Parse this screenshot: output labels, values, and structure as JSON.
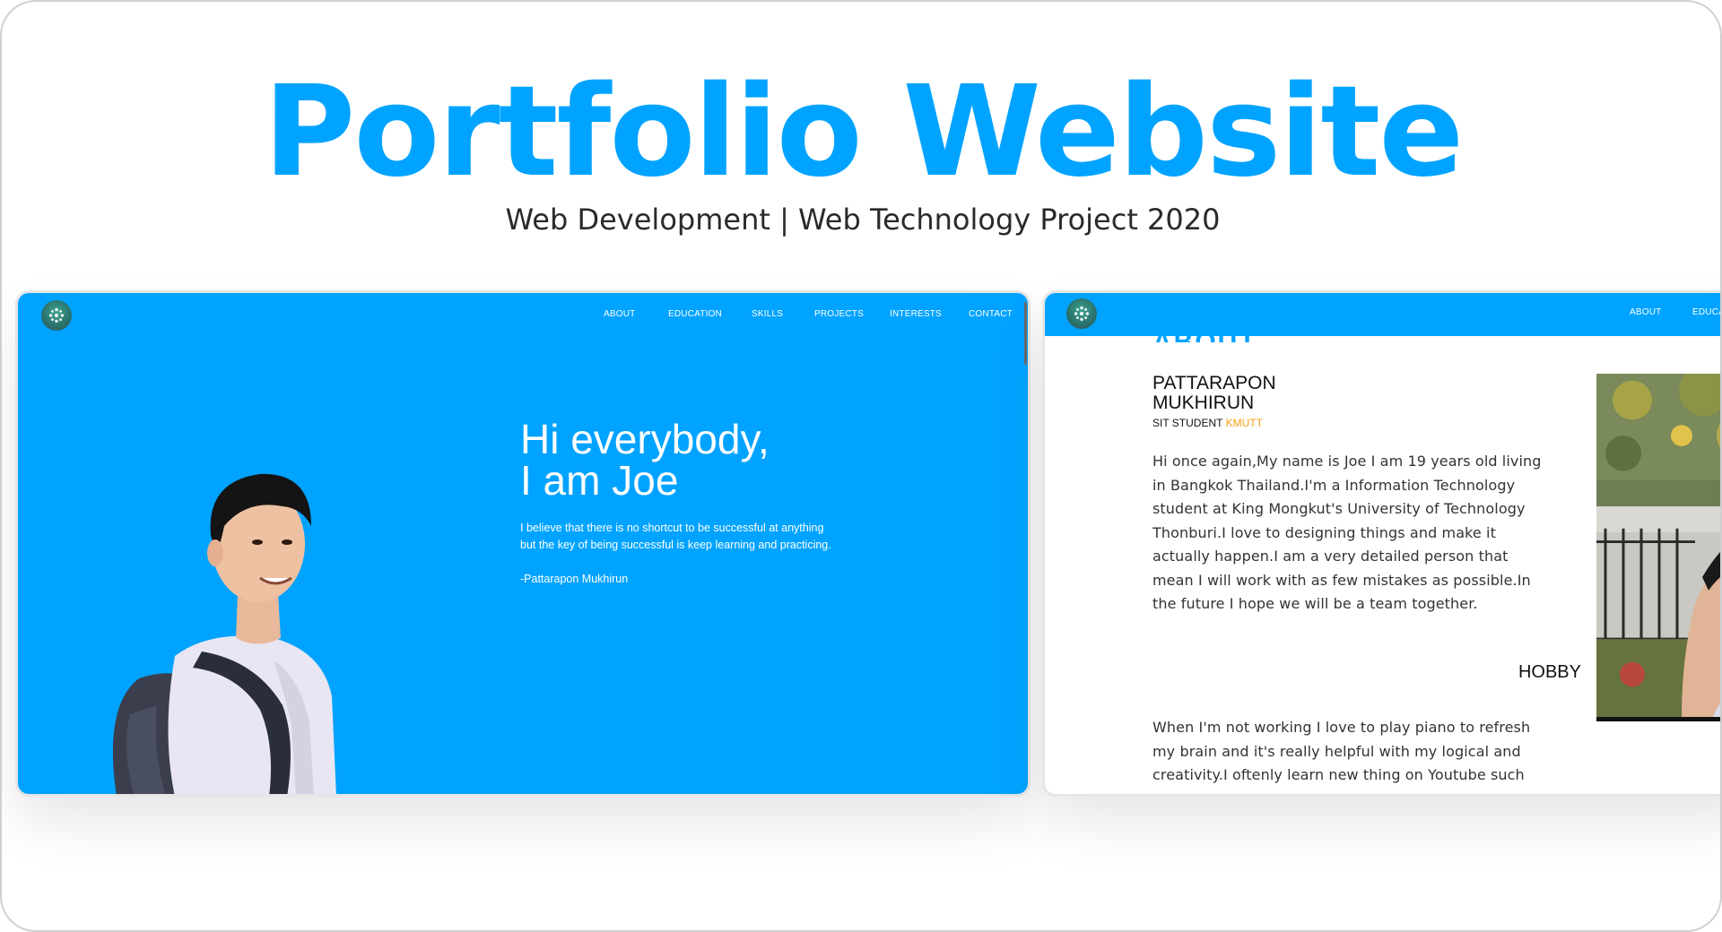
{
  "header": {
    "title": "Portfolio Website",
    "subtitle": "Web Development | Web Technology Project 2020"
  },
  "colors": {
    "brand_blue": "#00a3ff",
    "accent_orange": "#f39c12",
    "text_dark": "#111111"
  },
  "hero_screen": {
    "nav": [
      "ABOUT",
      "EDUCATION",
      "SKILLS",
      "PROJECTS",
      "INTERESTS",
      "CONTACT"
    ],
    "logo_icon": "flower-logo-icon",
    "heading_line1": "Hi everybody,",
    "heading_line2": "I am Joe",
    "quote_line1": "I believe that there is no shortcut to be successful at anything",
    "quote_line2": "but the key of being successful is keep learning and practicing.",
    "author": "-Pattarapon Mukhirun"
  },
  "about_screen": {
    "nav": [
      "ABOUT",
      "EDUCA"
    ],
    "section_peek": "ABOUT",
    "name_line1": "PATTARAPON",
    "name_line2": "MUKHIRUN",
    "role_prefix": "SIT STUDENT ",
    "role_accent": "KMUTT",
    "bio_lines": [
      "Hi once again,My name is Joe I am 19 years old living",
      "in Bangkok Thailand.I'm a Information Technology",
      "student at King Mongkut's University of Technology",
      "Thonburi.I love to designing things and make it",
      "actually happen.I am a very detailed person that",
      "mean I will work with as few mistakes as possible.In",
      "the future I hope we will be a team together."
    ],
    "hobby_title": "HOBBY",
    "hobby_lines": [
      "When I'm not working I love to play piano to refresh",
      "my brain and it's really helpful with my logical and",
      "creativity.I oftenly learn new thing on Youtube such"
    ]
  }
}
